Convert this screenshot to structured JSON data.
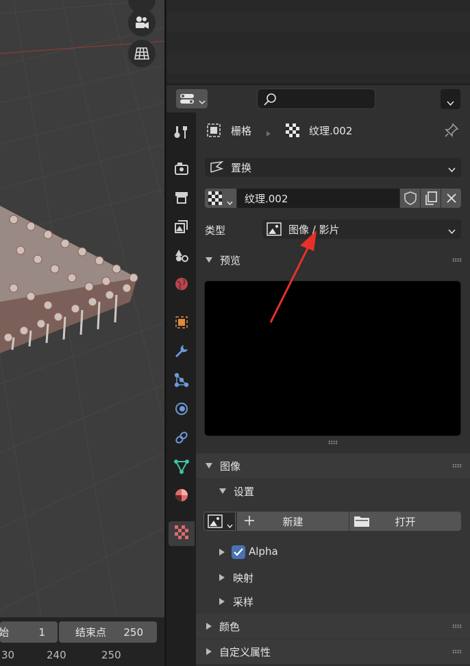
{
  "viewport": {
    "camera_button": "camera-view",
    "grid_button": "ortho-grid"
  },
  "timeline": {
    "start_label": "始",
    "start_value": "1",
    "end_label": "结束点",
    "end_value": "250",
    "ruler": [
      "30",
      "240",
      "250"
    ]
  },
  "properties": {
    "breadcrumb": {
      "object": "栅格",
      "texture": "纹理.002"
    },
    "modifier": {
      "label": "置换"
    },
    "texture_datablock": {
      "name": "纹理.002"
    },
    "type_row": {
      "label": "类型",
      "value": "图像 / 影片"
    },
    "preview_panel": {
      "title": "预览"
    },
    "image_panel": {
      "title": "图像",
      "settings_label": "设置",
      "new_label": "新建",
      "open_label": "打开",
      "alpha_label": "Alpha",
      "alpha_checked": true,
      "mapping_label": "映射",
      "sampling_label": "采样"
    },
    "color_panel": {
      "title": "颜色"
    },
    "custom_props_panel": {
      "title": "自定义属性"
    }
  },
  "colors": {
    "annotation_arrow": "#e8302a",
    "checkbox_accent": "#4772b3",
    "texture_tab": "#e06a6a"
  }
}
